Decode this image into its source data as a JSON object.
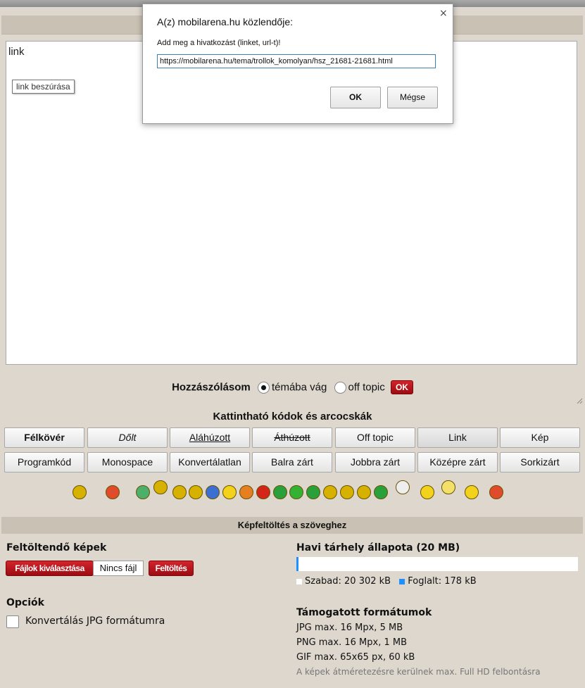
{
  "dialog": {
    "title": "A(z) mobilarena.hu közlendője:",
    "close_glyph": "×",
    "message": "Add meg a hivatkozást (linket, url-t)!",
    "input_value": "https://mobilarena.hu/tema/trollok_komolyan/hsz_21681-21681.html",
    "ok_label": "OK",
    "cancel_label": "Mégse"
  },
  "editor": {
    "text": "link",
    "tooltip": "link beszúrása"
  },
  "post_target": {
    "label": "Hozzászólásom",
    "option_topic": "témába vág",
    "option_offtopic": "off topic",
    "selected": "témába vág",
    "ok_label": "OK"
  },
  "codes": {
    "title": "Kattintható kódok és arcocskák",
    "row1": [
      "Félkövér",
      "Dőlt",
      "Aláhúzott",
      "Áthúzott",
      "Off topic",
      "Link",
      "Kép"
    ],
    "row2": [
      "Programkód",
      "Monospace",
      "Konvertálatlan",
      "Balra zárt",
      "Jobbra zárt",
      "Középre zárt",
      "Sorkizárt"
    ]
  },
  "smileys": [
    "smile-icon",
    "red-face-icon",
    "grin-icon",
    "alien-icon",
    "sad-icon",
    "smile2-icon",
    "blue-face-icon",
    "worried-icon",
    "angry-icon",
    "red-angry-icon",
    "green-face-icon",
    "green-devil-icon",
    "green-grin-icon",
    "wink-icon",
    "smirk-icon",
    "happy-icon",
    "green-sick-icon",
    "skull-icon",
    "confused-icon",
    "shocked-icon",
    "sleepy-icon",
    "rocket-icon"
  ],
  "upload": {
    "header": "Képfeltöltés a szöveghez",
    "images_title": "Feltöltendő képek",
    "choose_files": "Fájlok kiválasztása",
    "no_file": "Nincs fájl",
    "upload_btn": "Feltöltés",
    "options_title": "Opciók",
    "convert_jpg": "Konvertálás JPG formátumra",
    "storage_title": "Havi tárhely állapota (20 MB)",
    "used_fraction": 0.0087,
    "free_label": "Szabad: 20 302 kB",
    "used_label": "Foglalt: 178 kB",
    "formats_title": "Támogatott formátumok",
    "jpg": "JPG max. 16 Mpx, 5 MB",
    "png": "PNG max. 16 Mpx, 1 MB",
    "gif": "GIF max. 65x65 px, 60 kB",
    "note": "A képek átméretezésre kerülnek max. Full HD felbontásra"
  },
  "colors": {
    "accent_red": "#b3161d",
    "bar_blue": "#1e90ff"
  }
}
